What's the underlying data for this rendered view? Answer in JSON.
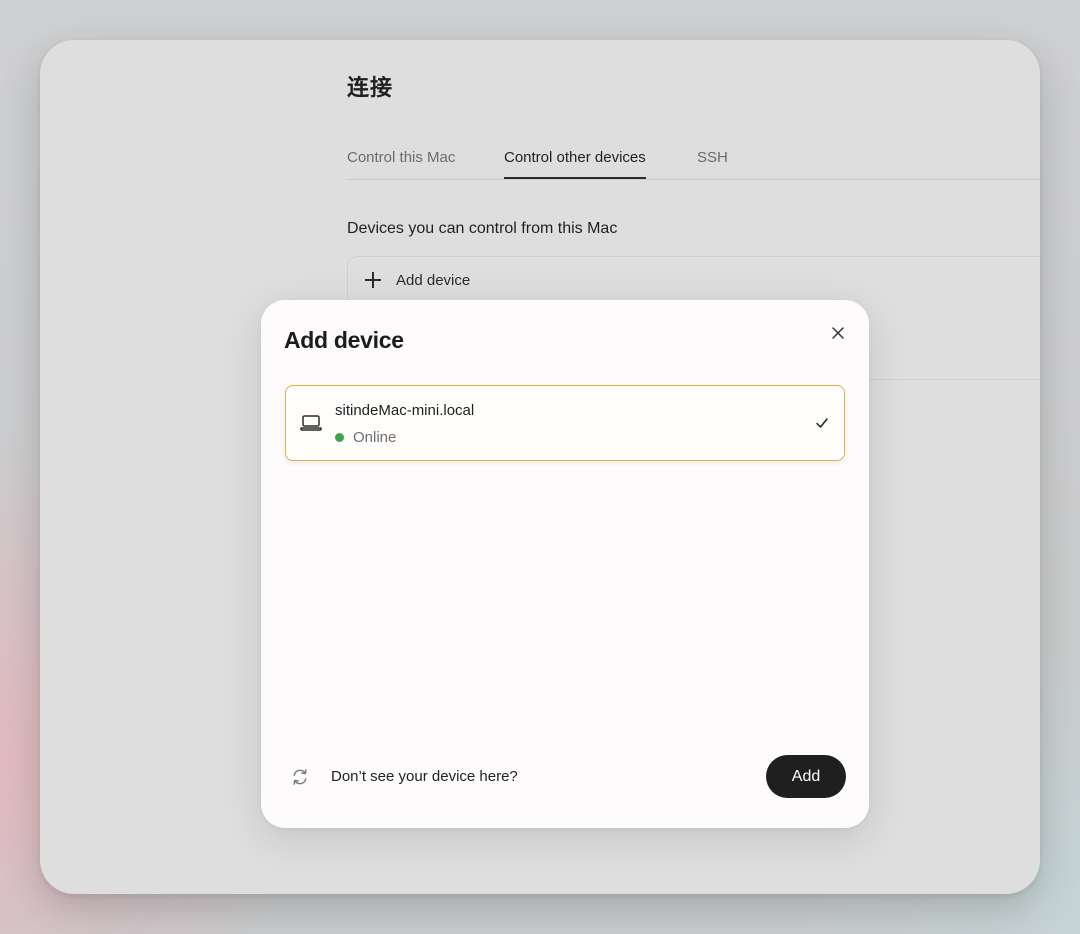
{
  "page": {
    "title": "连接"
  },
  "tabs": [
    {
      "label": "Control this Mac",
      "active": false
    },
    {
      "label": "Control other devices",
      "active": true
    },
    {
      "label": "SSH",
      "active": false
    }
  ],
  "devices_section": {
    "heading": "Devices you can control from this Mac",
    "add_device_label": "Add device"
  },
  "modal": {
    "title": "Add device",
    "close_icon": "close-icon",
    "device": {
      "icon": "laptop-icon",
      "name": "sitindeMac-mini.local",
      "status": "Online",
      "status_color": "#3fa34d",
      "selected": true
    },
    "footer": {
      "refresh_icon": "refresh-icon",
      "help_text": "Don’t see your device here?",
      "add_button_label": "Add"
    }
  },
  "colors": {
    "selected_border": "#e2b04a",
    "primary_button": "#1f1f1f"
  }
}
